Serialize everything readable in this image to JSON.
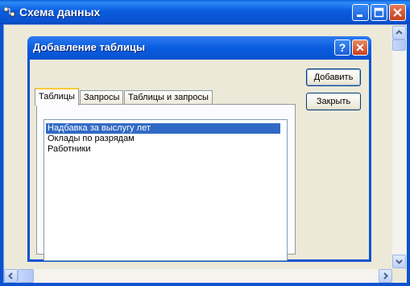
{
  "window": {
    "title": "Схема данных"
  },
  "dialog": {
    "title": "Добавление таблицы",
    "help_glyph": "?",
    "close_glyph": "✕",
    "tabs": [
      {
        "label": "Таблицы",
        "active": true
      },
      {
        "label": "Запросы",
        "active": false
      },
      {
        "label": "Таблицы и запросы",
        "active": false
      }
    ],
    "list_items": [
      {
        "label": "Надбавка за выслугу лет",
        "selected": true
      },
      {
        "label": "Оклады по разрядам",
        "selected": false
      },
      {
        "label": "Работники",
        "selected": false
      }
    ],
    "add_button": "Добавить",
    "close_button": "Закрыть"
  },
  "icons": {
    "window_icon": "relationships-icon",
    "minimize": "minimize-icon",
    "maximize": "maximize-icon",
    "close": "close-icon"
  },
  "colors": {
    "titlebar": "#0a52d0",
    "selection": "#316ac5",
    "tab_highlight": "#ffc83c"
  }
}
